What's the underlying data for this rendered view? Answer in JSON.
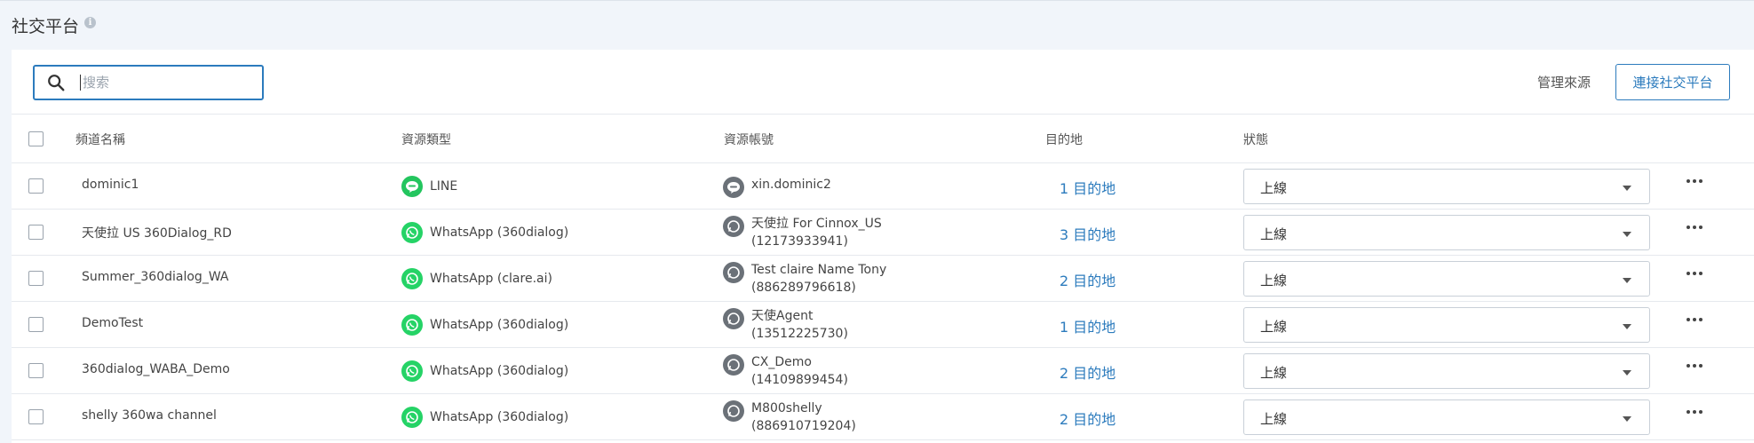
{
  "page": {
    "title": "社交平台",
    "info_icon": "i"
  },
  "toolbar": {
    "search_placeholder": "搜索",
    "manage_label": "管理來源",
    "connect_label": "連接社交平台"
  },
  "columns": {
    "channel_name": "頻道名稱",
    "source_type": "資源類型",
    "source_account": "資源帳號",
    "destination": "目的地",
    "status": "狀態"
  },
  "icons": {
    "line": "line-icon",
    "whatsapp": "whatsapp-icon",
    "account": "account-icon"
  },
  "colors": {
    "accent": "#2c7bbd",
    "line_green": "#23c55e",
    "whatsapp_green": "#25d366",
    "account_gray": "#6b7178"
  },
  "rows": [
    {
      "name": "dominic1",
      "type": "LINE",
      "type_icon": "line",
      "account_line1": "xin.dominic2",
      "account_line2": "",
      "dest": "1 目的地",
      "status": "上線"
    },
    {
      "name": "天使拉 US 360Dialog_RD",
      "type": "WhatsApp (360dialog)",
      "type_icon": "whatsapp",
      "account_line1": "天使拉 For Cinnox_US",
      "account_line2": "(12173933941)",
      "dest": "3 目的地",
      "status": "上線"
    },
    {
      "name": "Summer_360dialog_WA",
      "type": "WhatsApp (clare.ai)",
      "type_icon": "whatsapp",
      "account_line1": "Test claire Name Tony",
      "account_line2": "(886289796618)",
      "dest": "2 目的地",
      "status": "上線"
    },
    {
      "name": "DemoTest",
      "type": "WhatsApp (360dialog)",
      "type_icon": "whatsapp",
      "account_line1": "天使Agent",
      "account_line2": "(13512225730)",
      "dest": "1 目的地",
      "status": "上線"
    },
    {
      "name": "360dialog_WABA_Demo",
      "type": "WhatsApp (360dialog)",
      "type_icon": "whatsapp",
      "account_line1": "CX_Demo",
      "account_line2": "(14109899454)",
      "dest": "2 目的地",
      "status": "上線"
    },
    {
      "name": "shelly 360wa channel",
      "type": "WhatsApp (360dialog)",
      "type_icon": "whatsapp",
      "account_line1": "M800shelly",
      "account_line2": "(886910719204)",
      "dest": "2 目的地",
      "status": "上線"
    }
  ]
}
